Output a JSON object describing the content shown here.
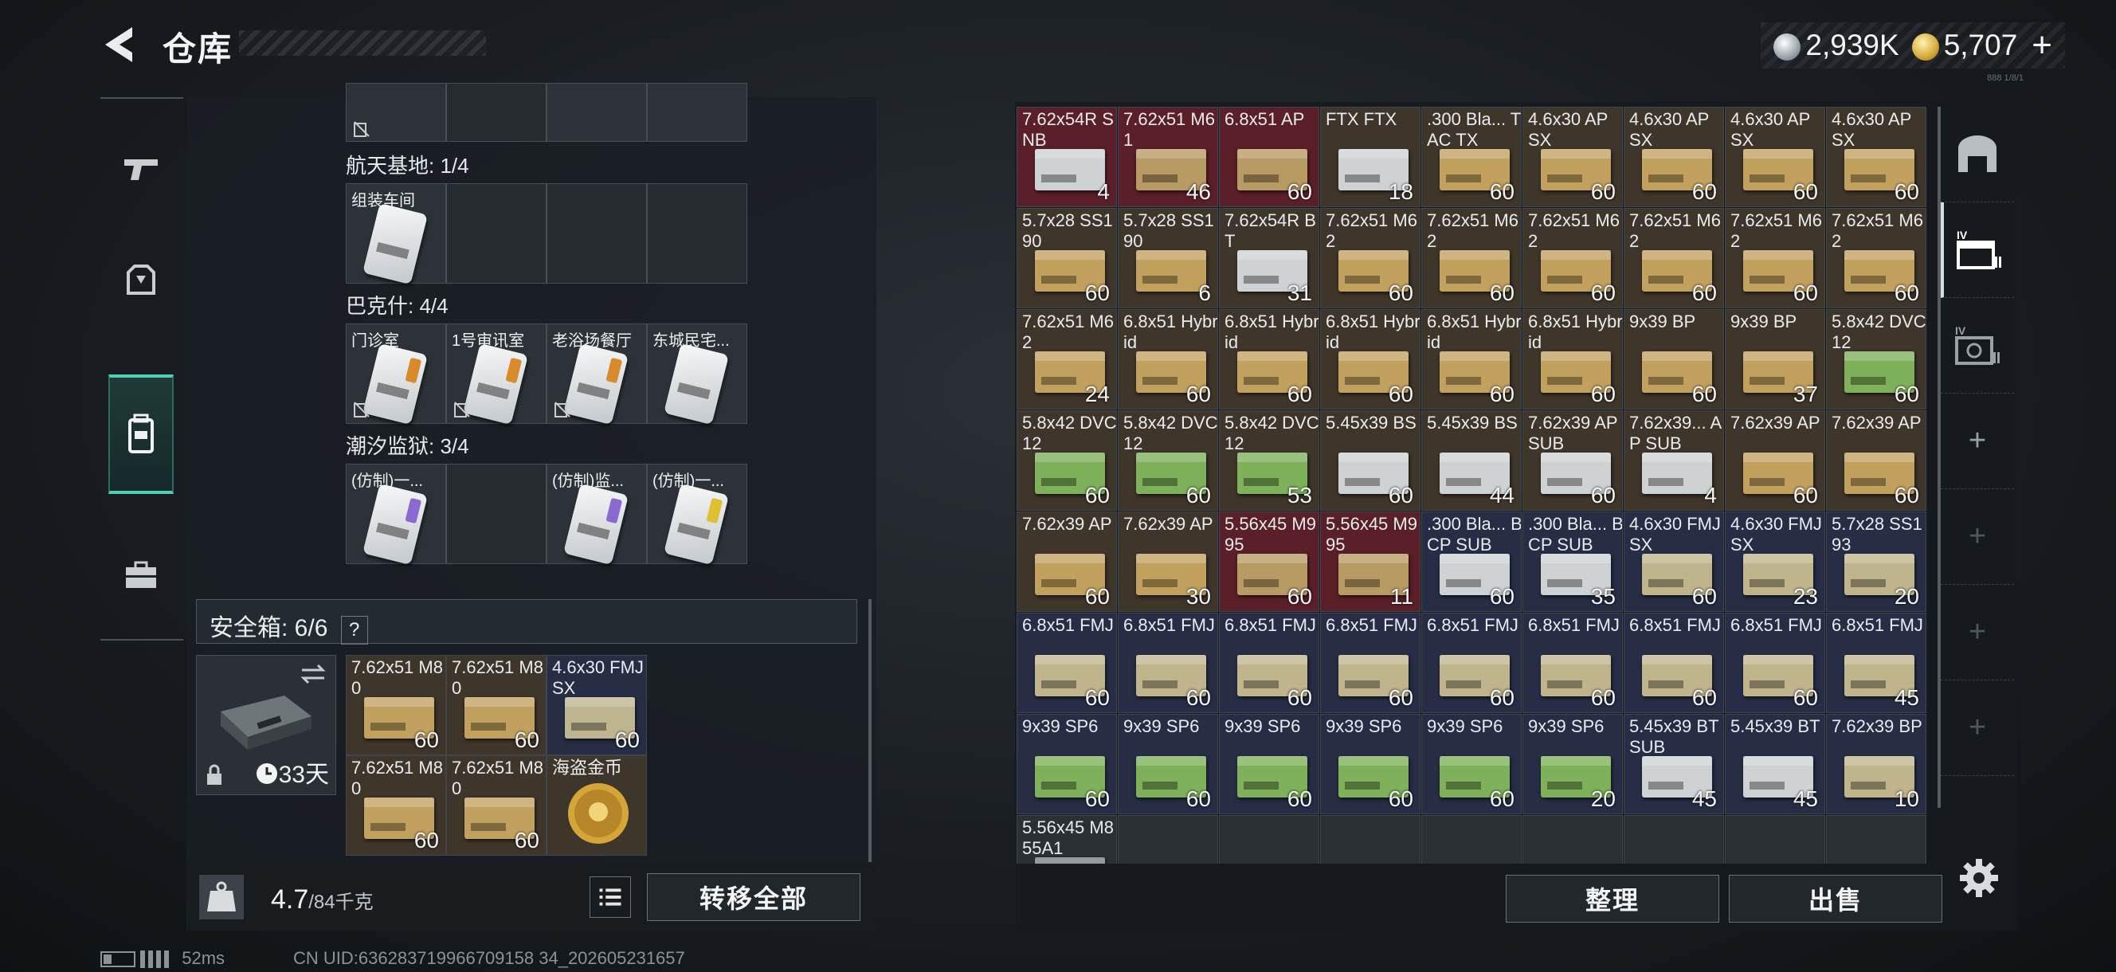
{
  "header": {
    "title": "仓库",
    "silver": "2,939K",
    "gold": "5,707",
    "plus": "+",
    "tiny_text": "888 1/8/1"
  },
  "nav": [
    "weapon-icon",
    "armor-icon",
    "backpack-icon",
    "case-icon"
  ],
  "left": {
    "sections": [
      {
        "title": "航天基地: 1/4",
        "cards": [
          "组装车间",
          "",
          "",
          ""
        ]
      },
      {
        "title": "巴克什: 4/4",
        "cards": [
          "门诊室",
          "1号审讯室",
          "老浴场餐厅",
          "东城民宅..."
        ]
      },
      {
        "title": "潮汐监狱: 3/4",
        "cards": [
          "(仿制)一...",
          "",
          "(仿制)监...",
          "(仿制)一..."
        ]
      }
    ],
    "safe": {
      "title": "安全箱: 6/6",
      "help": "?",
      "days": "33天",
      "items": [
        {
          "name": "7.62x51 M80",
          "qty": "60"
        },
        {
          "name": "7.62x51 M80",
          "qty": "60"
        },
        {
          "name": "4.6x30 FMJ SX",
          "qty": "60"
        },
        {
          "name": "7.62x51 M80",
          "qty": "60"
        },
        {
          "name": "7.62x51 M80",
          "qty": "60"
        },
        {
          "name": "海盗金币",
          "qty": ""
        }
      ]
    },
    "weight": "4.7",
    "weight_max": "/84千克",
    "transfer_all": "转移全部"
  },
  "stash": {
    "rows": [
      [
        [
          "7.62x54R SNB",
          "4",
          "red"
        ],
        [
          "7.62x51 M61",
          "46",
          "red"
        ],
        [
          "6.8x51 AP",
          "60",
          "red"
        ],
        [
          "FTX FTX",
          "18",
          "brown"
        ],
        [
          ".300 Bla... TAC TX",
          "60",
          "brown"
        ],
        [
          "4.6x30 AP SX",
          "60",
          "brown"
        ],
        [
          "4.6x30 AP SX",
          "60",
          "brown"
        ],
        [
          "4.6x30 AP SX",
          "60",
          "brown"
        ],
        [
          "4.6x30 AP SX",
          "60",
          "brown"
        ]
      ],
      [
        [
          "5.7x28 SS190",
          "60",
          "brown"
        ],
        [
          "5.7x28 SS190",
          "6",
          "brown"
        ],
        [
          "7.62x54R BT",
          "31",
          "brown"
        ],
        [
          "7.62x51 M62",
          "60",
          "brown"
        ],
        [
          "7.62x51 M62",
          "60",
          "brown"
        ],
        [
          "7.62x51 M62",
          "60",
          "brown"
        ],
        [
          "7.62x51 M62",
          "60",
          "brown"
        ],
        [
          "7.62x51 M62",
          "60",
          "brown"
        ],
        [
          "7.62x51 M62",
          "60",
          "brown"
        ]
      ],
      [
        [
          "7.62x51 M62",
          "24",
          "brown"
        ],
        [
          "6.8x51 Hybrid",
          "60",
          "brown"
        ],
        [
          "6.8x51 Hybrid",
          "60",
          "brown"
        ],
        [
          "6.8x51 Hybrid",
          "60",
          "brown"
        ],
        [
          "6.8x51 Hybrid",
          "60",
          "brown"
        ],
        [
          "6.8x51 Hybrid",
          "60",
          "brown"
        ],
        [
          "9x39 BP",
          "60",
          "brown"
        ],
        [
          "9x39 BP",
          "37",
          "brown"
        ],
        [
          "5.8x42 DVC12",
          "60",
          "brown"
        ]
      ],
      [
        [
          "5.8x42 DVC12",
          "60",
          "brown"
        ],
        [
          "5.8x42 DVC12",
          "60",
          "brown"
        ],
        [
          "5.8x42 DVC12",
          "53",
          "brown"
        ],
        [
          "5.45x39 BS",
          "60",
          "brown"
        ],
        [
          "5.45x39 BS",
          "44",
          "brown"
        ],
        [
          "7.62x39 AP SUB",
          "60",
          "brown"
        ],
        [
          "7.62x39... AP SUB",
          "4",
          "brown"
        ],
        [
          "7.62x39 AP",
          "60",
          "brown"
        ],
        [
          "7.62x39 AP",
          "60",
          "brown"
        ]
      ],
      [
        [
          "7.62x39 AP",
          "60",
          "brown"
        ],
        [
          "7.62x39 AP",
          "30",
          "brown"
        ],
        [
          "5.56x45 M995",
          "60",
          "red"
        ],
        [
          "5.56x45 M995",
          "11",
          "red"
        ],
        [
          ".300 Bla... BCP SUB",
          "60",
          "navy"
        ],
        [
          ".300 Bla... BCP SUB",
          "35",
          "navy"
        ],
        [
          "4.6x30 FMJ SX",
          "60",
          "navy"
        ],
        [
          "4.6x30 FMJ SX",
          "23",
          "navy"
        ],
        [
          "5.7x28 SS193",
          "20",
          "navy"
        ]
      ],
      [
        [
          "6.8x51 FMJ",
          "60",
          "navy"
        ],
        [
          "6.8x51 FMJ",
          "60",
          "navy"
        ],
        [
          "6.8x51 FMJ",
          "60",
          "navy"
        ],
        [
          "6.8x51 FMJ",
          "60",
          "navy"
        ],
        [
          "6.8x51 FMJ",
          "60",
          "navy"
        ],
        [
          "6.8x51 FMJ",
          "60",
          "navy"
        ],
        [
          "6.8x51 FMJ",
          "60",
          "navy"
        ],
        [
          "6.8x51 FMJ",
          "60",
          "navy"
        ],
        [
          "6.8x51 FMJ",
          "45",
          "navy"
        ]
      ],
      [
        [
          "9x39 SP6",
          "60",
          "navy"
        ],
        [
          "9x39 SP6",
          "60",
          "navy"
        ],
        [
          "9x39 SP6",
          "60",
          "navy"
        ],
        [
          "9x39 SP6",
          "60",
          "navy"
        ],
        [
          "9x39 SP6",
          "60",
          "navy"
        ],
        [
          "9x39 SP6",
          "20",
          "navy"
        ],
        [
          "5.45x39 BT SUB",
          "45",
          "navy"
        ],
        [
          "5.45x39 BT",
          "45",
          "navy"
        ],
        [
          "7.62x39 BP",
          "10",
          "navy"
        ]
      ],
      [
        [
          "5.56x45 M855A1",
          "",
          "grey"
        ],
        [
          "",
          "",
          "grey"
        ],
        [
          "",
          "",
          "grey"
        ],
        [
          "",
          "",
          "grey"
        ],
        [
          "",
          "",
          "grey"
        ],
        [
          "",
          "",
          "grey"
        ],
        [
          "",
          "",
          "grey"
        ],
        [
          "",
          "",
          "grey"
        ],
        [
          "",
          "",
          "grey"
        ]
      ]
    ],
    "sort": "整理",
    "sell": "出售"
  },
  "right_nav": [
    "storage-icon",
    "iv-stash-icon",
    "iv-stash-2-icon",
    "+",
    "+",
    "+",
    "+"
  ],
  "status": {
    "ping": "52ms",
    "uid": "CN UID:636283719966709158 34_202605231657"
  },
  "colors": {
    "red": "#5a1f28",
    "brown": "#3e352b",
    "navy": "#262d45",
    "accent": "#4fd0b0"
  }
}
